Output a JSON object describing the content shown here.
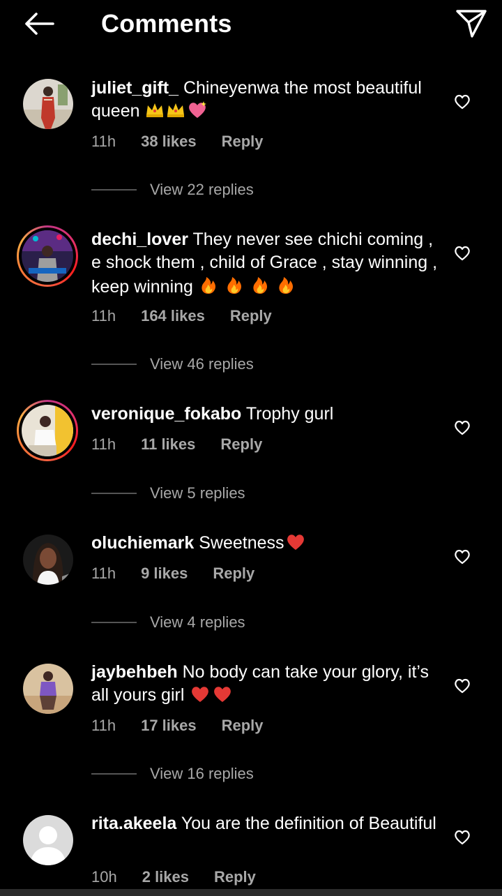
{
  "header": {
    "title": "Comments",
    "back_icon": "arrow-left-icon",
    "share_icon": "send-icon"
  },
  "comments": [
    {
      "username": "juliet_gift_",
      "text": "Chineyenwa the most beautiful queen",
      "emoji": [
        "crown",
        "crown",
        "sparkling-heart"
      ],
      "time": "11h",
      "likes": "38 likes",
      "reply": "Reply",
      "view_replies": "View 22 replies",
      "story_ring": false
    },
    {
      "username": "dechi_lover",
      "text": "They never see chichi coming , e shock them , child of Grace , stay winning , keep winning",
      "emoji": [
        "fire",
        "fire",
        "fire",
        "fire"
      ],
      "time": "11h",
      "likes": "164 likes",
      "reply": "Reply",
      "view_replies": "View 46 replies",
      "story_ring": true
    },
    {
      "username": "veronique_fokabo",
      "text": "Trophy gurl",
      "emoji": [],
      "time": "11h",
      "likes": "11 likes",
      "reply": "Reply",
      "view_replies": "View 5 replies",
      "story_ring": true
    },
    {
      "username": "oluchiemark",
      "text": "Sweetness",
      "emoji": [
        "red-heart"
      ],
      "time": "11h",
      "likes": "9 likes",
      "reply": "Reply",
      "view_replies": "View 4 replies",
      "story_ring": false
    },
    {
      "username": "jaybehbeh",
      "text": "No body can take your glory, it’s all yours girl",
      "emoji": [
        "red-heart",
        "red-heart"
      ],
      "time": "11h",
      "likes": "17 likes",
      "reply": "Reply",
      "view_replies": "View 16 replies",
      "story_ring": false
    },
    {
      "username": "rita.akeela",
      "text": "You are the definition of Beautiful",
      "emoji": [],
      "time": "10h",
      "likes": "2 likes",
      "reply": "Reply",
      "story_ring": false
    }
  ],
  "colors": {
    "background": "#000000",
    "text": "#ffffff",
    "secondary_text": "#a8a8a8",
    "divider": "#555555"
  }
}
